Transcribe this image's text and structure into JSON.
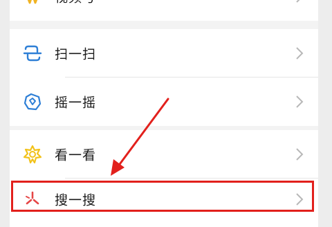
{
  "menu": {
    "items": [
      {
        "label": "视频号",
        "icon": "video-channel-icon"
      },
      {
        "label": "扫一扫",
        "icon": "scan-icon"
      },
      {
        "label": "摇一摇",
        "icon": "shake-icon"
      },
      {
        "label": "看一看",
        "icon": "top-stories-icon"
      },
      {
        "label": "搜一搜",
        "icon": "search-icon"
      }
    ]
  },
  "annotation": {
    "highlight_color": "#e2201c",
    "target": "搜一搜"
  }
}
